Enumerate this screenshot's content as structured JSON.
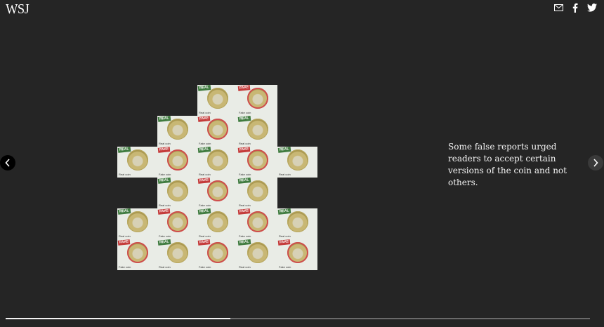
{
  "header": {
    "logo": "WSJ",
    "share": [
      {
        "name": "email-icon"
      },
      {
        "name": "facebook-icon"
      },
      {
        "name": "twitter-icon"
      }
    ]
  },
  "slide": {
    "caption": "Some false reports urged readers to accept certain versions of the coin and not others.",
    "progress_fraction": 0.385
  },
  "tiles": [
    {
      "row": 0,
      "col": 2,
      "kind": "real"
    },
    {
      "row": 0,
      "col": 3,
      "kind": "fake"
    },
    {
      "row": 1,
      "col": 1,
      "kind": "real"
    },
    {
      "row": 1,
      "col": 2,
      "kind": "fake"
    },
    {
      "row": 1,
      "col": 3,
      "kind": "real"
    },
    {
      "row": 2,
      "col": 0,
      "kind": "real"
    },
    {
      "row": 2,
      "col": 1,
      "kind": "fake"
    },
    {
      "row": 2,
      "col": 2,
      "kind": "real"
    },
    {
      "row": 2,
      "col": 3,
      "kind": "fake"
    },
    {
      "row": 2,
      "col": 4,
      "kind": "real"
    },
    {
      "row": 3,
      "col": 1,
      "kind": "real"
    },
    {
      "row": 3,
      "col": 2,
      "kind": "fake"
    },
    {
      "row": 3,
      "col": 3,
      "kind": "real"
    },
    {
      "row": 4,
      "col": 0,
      "kind": "real"
    },
    {
      "row": 4,
      "col": 1,
      "kind": "fake"
    },
    {
      "row": 4,
      "col": 2,
      "kind": "real"
    },
    {
      "row": 4,
      "col": 3,
      "kind": "fake"
    },
    {
      "row": 4,
      "col": 4,
      "kind": "real"
    },
    {
      "row": 5,
      "col": 0,
      "kind": "fake"
    },
    {
      "row": 5,
      "col": 1,
      "kind": "real"
    },
    {
      "row": 5,
      "col": 2,
      "kind": "fake"
    },
    {
      "row": 5,
      "col": 3,
      "kind": "real"
    },
    {
      "row": 5,
      "col": 4,
      "kind": "fake"
    }
  ],
  "tile_labels": {
    "real_stamp": "REAL",
    "fake_stamp": "FAKE",
    "real_caption": "Real coin",
    "fake_caption": "Fake coin"
  }
}
